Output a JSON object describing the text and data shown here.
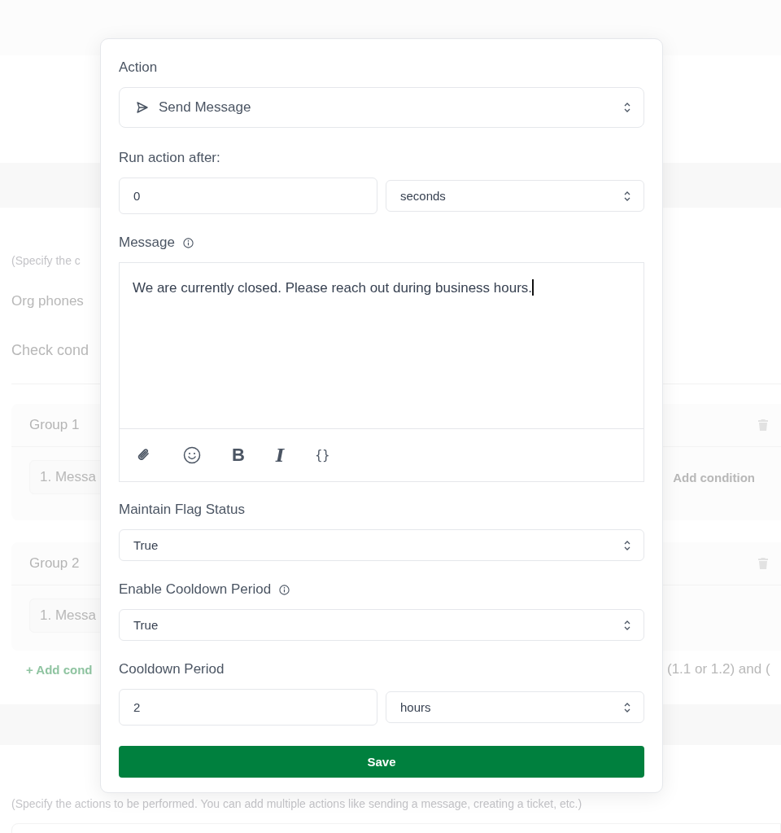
{
  "background": {
    "conditions_hint": "(Specify the c",
    "org_phones_label": "Org phones",
    "check_conditions_label": "Check cond",
    "groups": [
      {
        "title": "Group 1",
        "condition": "1. Messa",
        "add_condition": "Add condition"
      },
      {
        "title": "Group 2",
        "condition": "1. Messa"
      }
    ],
    "add_condition_group": "+ Add cond",
    "expression": "(1.1 or 1.2) and (",
    "actions_hint": "(Specify the actions to be performed. You can add multiple actions like sending a message, creating a ticket, etc.)"
  },
  "modal": {
    "action": {
      "label": "Action",
      "value": "Send Message"
    },
    "delay": {
      "label": "Run action after:",
      "value": "0",
      "unit": "seconds"
    },
    "message": {
      "label": "Message",
      "value": "We are currently closed. Please reach out during business hours.",
      "toolbar": [
        {
          "kind": "attach"
        },
        {
          "kind": "emoji"
        },
        {
          "kind": "bold",
          "glyph": "B"
        },
        {
          "kind": "italic",
          "glyph": "I"
        },
        {
          "kind": "variable",
          "glyph": "{}"
        }
      ]
    },
    "fields": [
      {
        "kind": "select",
        "label": "Maintain Flag Status",
        "value": "True",
        "info": false
      },
      {
        "kind": "select",
        "label": "Enable Cooldown Period",
        "value": "True",
        "info": true
      },
      {
        "kind": "number_unit",
        "label": "Cooldown Period",
        "value": "2",
        "unit": "hours",
        "info": false
      }
    ],
    "save_button": "Save"
  }
}
